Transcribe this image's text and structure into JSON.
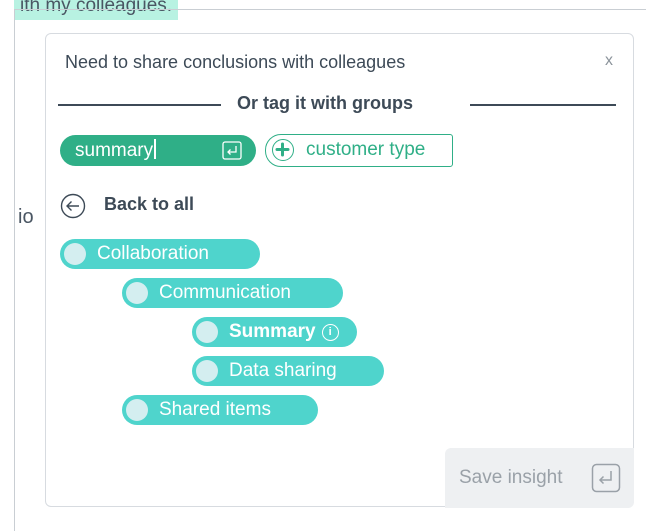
{
  "background": {
    "highlight_text": "ith my colleagues.",
    "fragment_text": "io"
  },
  "card": {
    "title": "Need to share conclusions with colleagues",
    "close_label": "x",
    "divider_text": "Or tag it with groups"
  },
  "tag_input": {
    "value": "summary",
    "enter_icon": "enter-icon"
  },
  "suggestion": {
    "label": "customer type",
    "icon": "plus-circle-icon"
  },
  "back": {
    "label": "Back to all",
    "icon": "arrow-left-circle-icon"
  },
  "tree": {
    "items": [
      {
        "label": "Collaboration",
        "level": 0,
        "bold": false
      },
      {
        "label": "Communication",
        "level": 1,
        "bold": false
      },
      {
        "label": "Summary",
        "level": 2,
        "bold": true,
        "info": true
      },
      {
        "label": "Data sharing",
        "level": 2,
        "bold": false
      },
      {
        "label": "Shared items",
        "level": 1,
        "bold": false
      }
    ]
  },
  "save_button": {
    "label": "Save insight",
    "icon": "enter-icon"
  },
  "colors": {
    "accent_green": "#2faf87",
    "tag_teal": "#4fd4cc",
    "text_dark": "#3d4a57",
    "highlight": "#b8f2e2"
  }
}
